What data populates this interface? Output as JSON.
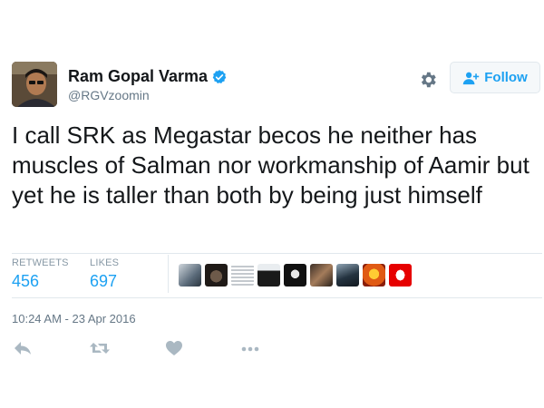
{
  "author": {
    "display_name": "Ram Gopal Varma",
    "handle": "@RGVzoomin",
    "verified": true,
    "verified_icon": "verified-badge-icon"
  },
  "header_actions": {
    "settings_icon": "gear-icon",
    "follow_label": "Follow",
    "follow_icon": "add-user-icon"
  },
  "tweet": {
    "text": "I call SRK as Megastar becos he neither has muscles of Salman nor workmanship of Aamir but yet he is taller than both by being just himself"
  },
  "stats": {
    "retweets_label": "RETWEETS",
    "retweets_value": "456",
    "likes_label": "LIKES",
    "likes_value": "697"
  },
  "likers": [
    {
      "name": "liker-avatar-1"
    },
    {
      "name": "liker-avatar-2"
    },
    {
      "name": "liker-avatar-3"
    },
    {
      "name": "liker-avatar-4"
    },
    {
      "name": "liker-avatar-5"
    },
    {
      "name": "liker-avatar-6"
    },
    {
      "name": "liker-avatar-7"
    },
    {
      "name": "liker-avatar-8"
    },
    {
      "name": "liker-avatar-9"
    }
  ],
  "timestamp": "10:24 AM - 23 Apr 2016",
  "actions": [
    "reply-icon",
    "retweet-icon",
    "like-icon",
    "more-icon"
  ],
  "colors": {
    "accent": "#1da1f2",
    "text": "#14171a",
    "muted": "#657786",
    "action_icon": "#aab8c2"
  }
}
